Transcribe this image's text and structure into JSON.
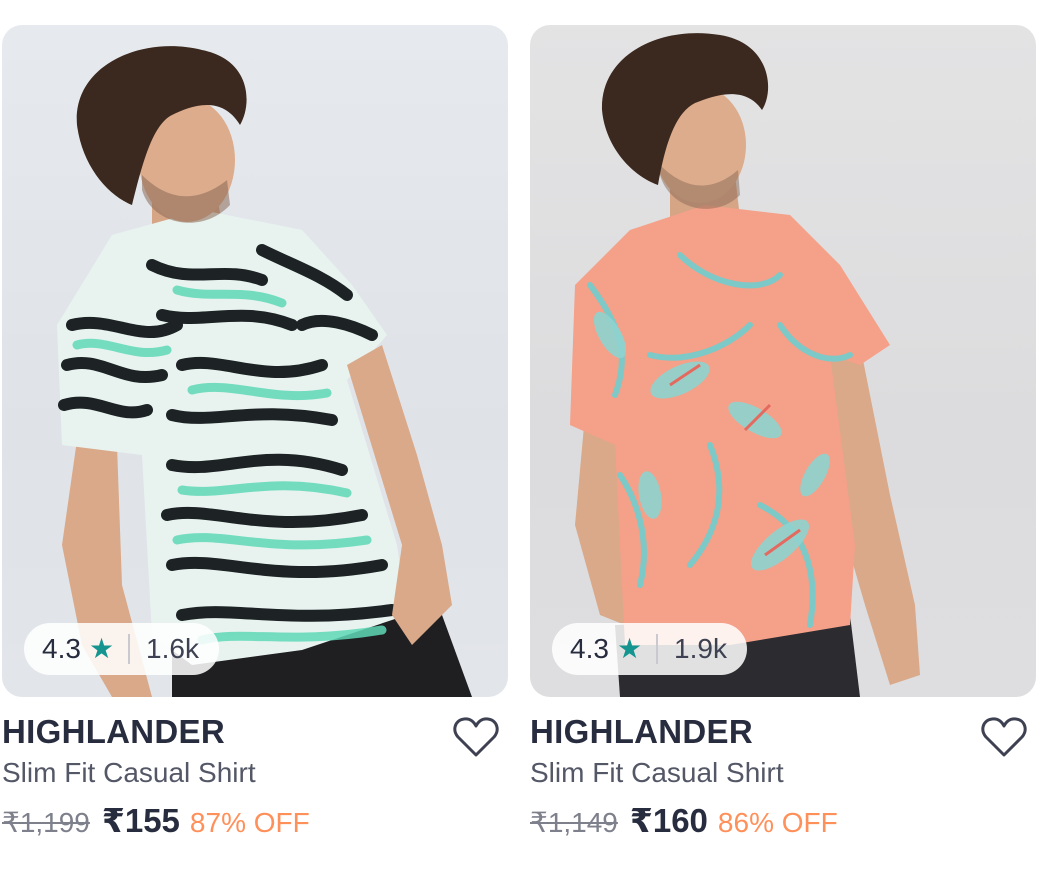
{
  "products": [
    {
      "brand": "HIGHLANDER",
      "name": "Slim Fit Casual Shirt",
      "rating": "4.3",
      "rating_count": "1.6k",
      "mrp": "₹1,199",
      "price": "₹155",
      "discount": "87% OFF",
      "shirt_pattern": "zebra-print-teal-black"
    },
    {
      "brand": "HIGHLANDER",
      "name": "Slim Fit Casual Shirt",
      "rating": "4.3",
      "rating_count": "1.9k",
      "mrp": "₹1,149",
      "price": "₹160",
      "discount": "86% OFF",
      "shirt_pattern": "peach-tropical-leaf-print"
    }
  ],
  "icons": {
    "rating": "star-icon",
    "wishlist": "heart-outline-icon"
  },
  "colors": {
    "star": "#14958f",
    "discount": "#ff905a",
    "brand_text": "#282c3f",
    "muted_text": "#7e818c"
  }
}
